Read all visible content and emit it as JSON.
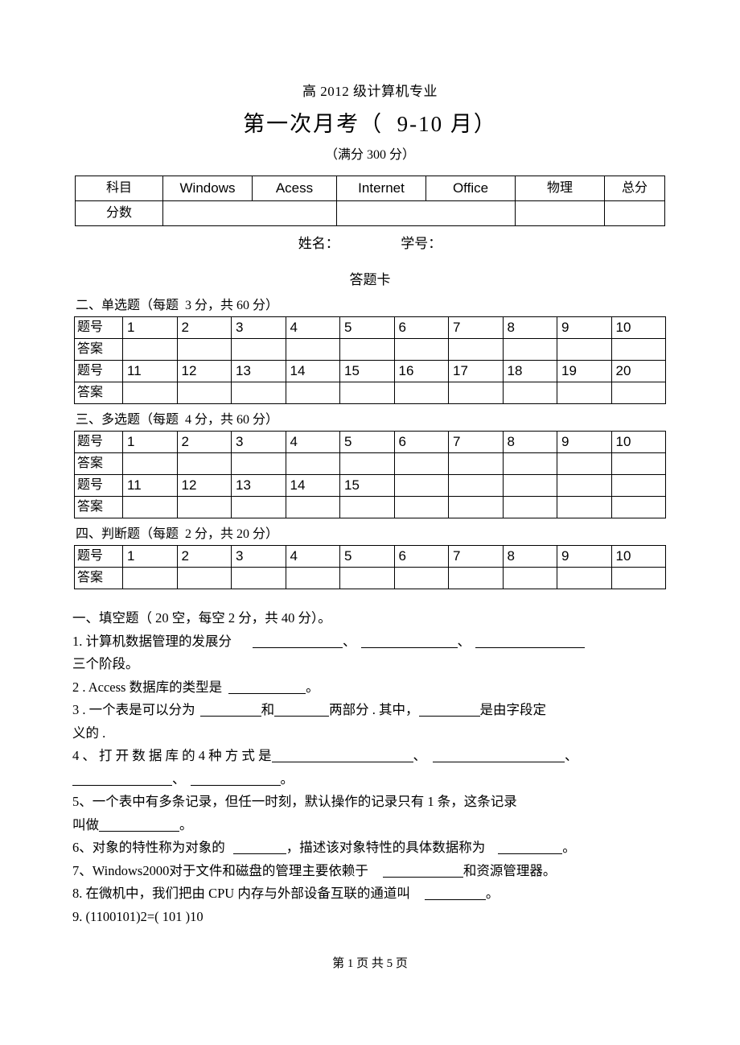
{
  "header": {
    "grade_line": "高 2012 级计算机专业",
    "title": "第一次月考（  9-10 月）",
    "full_marks": "（满分 300 分）"
  },
  "score_table": {
    "row_labels": [
      "科目",
      "分数"
    ],
    "subjects": [
      "Windows",
      "Acess",
      "Internet",
      "Office",
      "物理",
      "总分"
    ],
    "scores": [
      "",
      "",
      "",
      ""
    ]
  },
  "student_line": "姓名：                  学号：",
  "answer_sheet_label": "答题卡",
  "sections": [
    {
      "heading": "二、单选题（每题  3 分，共 60 分）",
      "rows": [
        {
          "label": "题号",
          "cells": [
            "1",
            "2",
            "3",
            "4",
            "5",
            "6",
            "7",
            "8",
            "9",
            "10"
          ]
        },
        {
          "label": "答案",
          "cells": [
            "",
            "",
            "",
            "",
            "",
            "",
            "",
            "",
            "",
            ""
          ]
        },
        {
          "label": "题号",
          "cells": [
            "11",
            "12",
            "13",
            "14",
            "15",
            "16",
            "17",
            "18",
            "19",
            "20"
          ]
        },
        {
          "label": "答案",
          "cells": [
            "",
            "",
            "",
            "",
            "",
            "",
            "",
            "",
            "",
            ""
          ]
        }
      ]
    },
    {
      "heading": "三、多选题（每题  4 分，共 60 分）",
      "rows": [
        {
          "label": "题号",
          "cells": [
            "1",
            "2",
            "3",
            "4",
            "5",
            "6",
            "7",
            "8",
            "9",
            "10"
          ]
        },
        {
          "label": "答案",
          "cells": [
            "",
            "",
            "",
            "",
            "",
            "",
            "",
            "",
            "",
            ""
          ]
        },
        {
          "label": "题号",
          "cells": [
            "11",
            "12",
            "13",
            "14",
            "15",
            "",
            "",
            "",
            "",
            ""
          ]
        },
        {
          "label": "答案",
          "cells": [
            "",
            "",
            "",
            "",
            "",
            "",
            "",
            "",
            "",
            ""
          ]
        }
      ]
    },
    {
      "heading": "四、判断题（每题  2 分，共 20 分）",
      "rows": [
        {
          "label": "题号",
          "cells": [
            "1",
            "2",
            "3",
            "4",
            "5",
            "6",
            "7",
            "8",
            "9",
            "10"
          ]
        },
        {
          "label": "答案",
          "cells": [
            "",
            "",
            "",
            "",
            "",
            "",
            "",
            "",
            "",
            ""
          ]
        }
      ]
    }
  ],
  "fill_section": {
    "heading": "一、填空题（ 20 空，每空 2 分，共 40 分）。",
    "q1_a": "1.  计算机数据管理的发展分",
    "q1_sep1": "、",
    "q1_sep2": "、",
    "q1_b": "三个阶段。",
    "q2_a": "2 .  Access  数据库的类型是",
    "q2_b": "。",
    "q3_a": "3 .  一个表是可以分为",
    "q3_b": "和",
    "q3_c": "两部分 . 其中，",
    "q3_d": "是由字段定",
    "q3_e": "义的 .",
    "q4_a": "4 、 打 开 数 据 库 的  4  种 方 式 是",
    "q4_sep1": "、",
    "q4_sep2": "、",
    "q4_sep3": "、",
    "q4_end": "。",
    "q5_a": "5、一个表中有多条记录，但任一时刻，默认操作的记录只有       1 条，这条记录",
    "q5_b": "叫做",
    "q5_c": "。",
    "q6_a": "6、对象的特性称为对象的",
    "q6_b": "，描述该对象特性的具体数据称为",
    "q6_c": "。",
    "q7_a": "7、Windows2000对于文件和磁盘的管理主要依赖于",
    "q7_b": "和资源管理器。",
    "q8_a": "8. 在微机中，我们把由  CPU  内存与外部设备互联的通道叫",
    "q8_b": "。",
    "q9": "9.  (1100101)2=(     101    )10"
  },
  "footer": "第 1 页 共 5 页"
}
